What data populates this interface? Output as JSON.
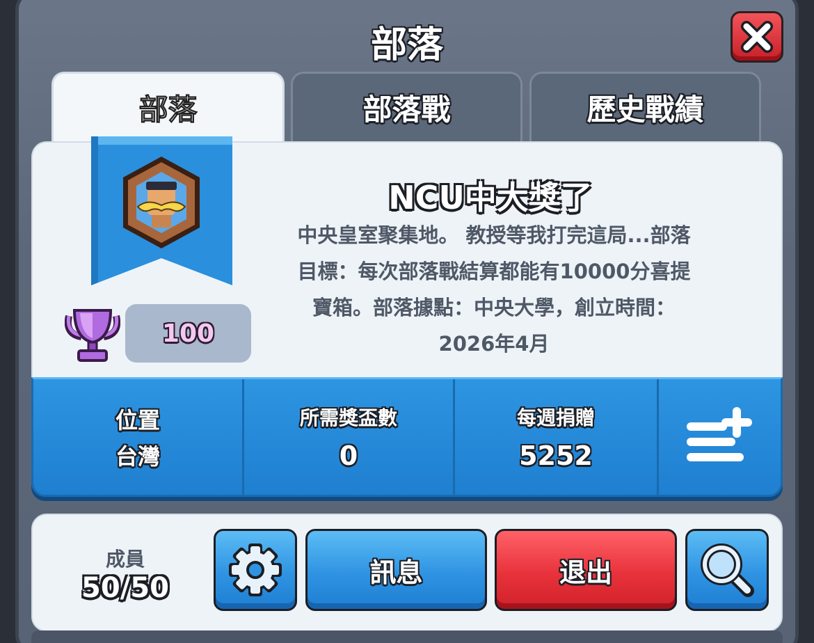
{
  "header": {
    "title": "部落"
  },
  "tabs": [
    {
      "label": "部落",
      "active": true
    },
    {
      "label": "部落戰",
      "active": false
    },
    {
      "label": "歷史戰績",
      "active": false
    }
  ],
  "clan": {
    "name": "NCU中大獎了",
    "description": "中央皇室聚集地。 教授等我打完這局...部落目標：每次部落戰結算都能有10000分喜提寶箱。部落據點：中央大學，創立時間：2026年4月",
    "description_lines": [
      "中央皇室聚集地。 教授等我打完這局...部落",
      "目標：每次部落戰結算都能有10000分喜提",
      "寶箱。部落據點：中央大學，創立時間：",
      "2026年4月"
    ],
    "trophies": "100",
    "badge_icon": "mustache-shield-icon"
  },
  "stats": {
    "location_label": "位置",
    "location_value": "台灣",
    "required_trophies_label": "所需獎盃數",
    "required_trophies_value": "0",
    "weekly_donations_label": "每週捐贈",
    "weekly_donations_value": "5252",
    "menu_icon": "list-add-icon"
  },
  "footer": {
    "members_label": "成員",
    "members_value": "50/50",
    "settings_icon": "gear-icon",
    "message_label": "訊息",
    "leave_label": "退出",
    "search_icon": "search-icon"
  },
  "colors": {
    "accent_blue": "#2d95e2",
    "danger_red": "#e8323b",
    "trophy_purple": "#b06be0"
  }
}
